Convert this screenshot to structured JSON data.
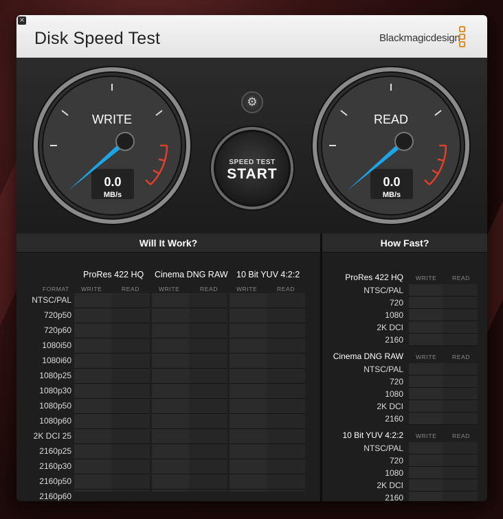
{
  "window": {
    "close_glyph": "×"
  },
  "header": {
    "title": "Disk Speed Test",
    "brand": "Blackmagicdesign"
  },
  "gauges": {
    "write": {
      "label": "WRITE",
      "value": "0.0",
      "unit": "MB/s"
    },
    "read": {
      "label": "READ",
      "value": "0.0",
      "unit": "MB/s"
    }
  },
  "controls": {
    "settings_icon": "gear-icon",
    "settings_glyph": "⚙",
    "start_small": "SPEED TEST",
    "start_big": "START"
  },
  "will_it_work": {
    "title": "Will It Work?",
    "format_label": "FORMAT",
    "codecs": [
      {
        "name": "ProRes 422 HQ",
        "write": "WRITE",
        "read": "READ"
      },
      {
        "name": "Cinema DNG RAW",
        "write": "WRITE",
        "read": "READ"
      },
      {
        "name": "10 Bit YUV 4:2:2",
        "write": "WRITE",
        "read": "READ"
      }
    ],
    "formats": [
      "NTSC/PAL",
      "720p50",
      "720p60",
      "1080i50",
      "1080i60",
      "1080p25",
      "1080p30",
      "1080p50",
      "1080p60",
      "2K DCI 25",
      "2160p25",
      "2160p30",
      "2160p50",
      "2160p60"
    ]
  },
  "how_fast": {
    "title": "How Fast?",
    "groups": [
      {
        "codec": "ProRes 422 HQ",
        "write": "WRITE",
        "read": "READ",
        "rows": [
          "NTSC/PAL",
          "720",
          "1080",
          "2K DCI",
          "2160"
        ]
      },
      {
        "codec": "Cinema DNG RAW",
        "write": "WRITE",
        "read": "READ",
        "rows": [
          "NTSC/PAL",
          "720",
          "1080",
          "2K DCI",
          "2160"
        ]
      },
      {
        "codec": "10 Bit YUV 4:2:2",
        "write": "WRITE",
        "read": "READ",
        "rows": [
          "NTSC/PAL",
          "720",
          "1080",
          "2K DCI",
          "2160"
        ]
      }
    ]
  },
  "colors": {
    "needle": "#1aa6e8",
    "redline": "#e0402a",
    "brand_accent": "#e0902a"
  }
}
